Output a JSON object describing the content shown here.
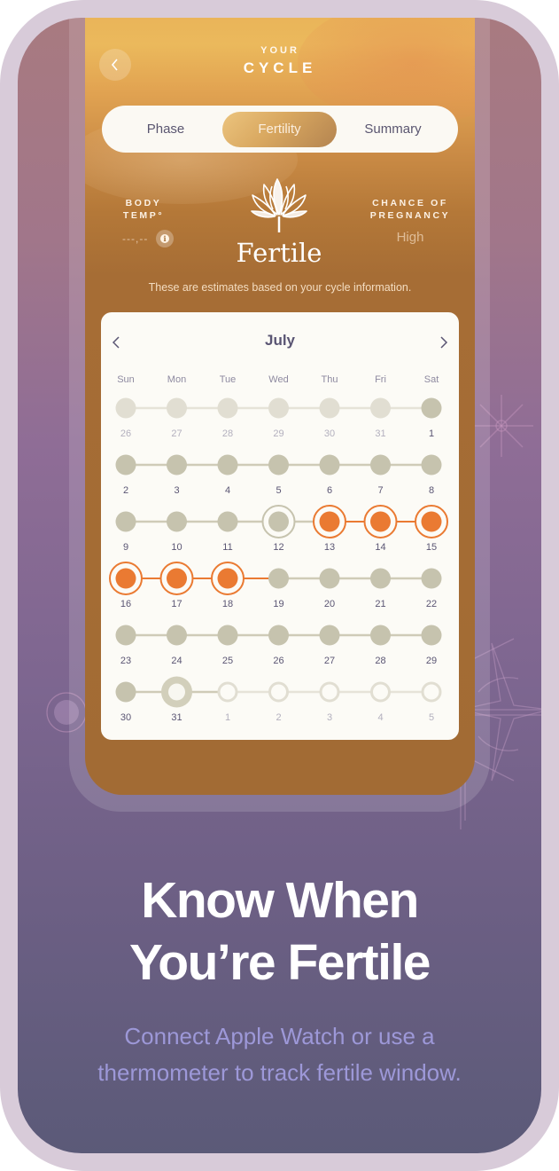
{
  "header": {
    "title_small": "YOUR",
    "title_big": "CYCLE",
    "back_icon": "chevron-left-icon"
  },
  "tabs": [
    {
      "label": "Phase",
      "active": false
    },
    {
      "label": "Fertility",
      "active": true
    },
    {
      "label": "Summary",
      "active": false
    }
  ],
  "body_temp": {
    "label_line1": "BODY",
    "label_line2": "TEMP°",
    "value": "---,--",
    "info_icon": "i"
  },
  "phase": {
    "icon": "lotus-flower-icon",
    "title": "Fertile"
  },
  "chance_of_pregnancy": {
    "label_line1": "CHANCE OF",
    "label_line2": "PREGNANCY",
    "value": "High"
  },
  "disclaimer": "These are estimates based on your cycle information.",
  "calendar": {
    "month": "July",
    "prev_icon": "chevron-left-icon",
    "next_icon": "chevron-right-icon",
    "weekdays": [
      "Sun",
      "Mon",
      "Tue",
      "Wed",
      "Thu",
      "Fri",
      "Sat"
    ],
    "weeks": [
      [
        {
          "day": "26",
          "state": "prev-month"
        },
        {
          "day": "27",
          "state": "prev-month"
        },
        {
          "day": "28",
          "state": "prev-month"
        },
        {
          "day": "29",
          "state": "prev-month"
        },
        {
          "day": "30",
          "state": "prev-month"
        },
        {
          "day": "31",
          "state": "prev-month"
        },
        {
          "day": "1",
          "state": "past"
        }
      ],
      [
        {
          "day": "2",
          "state": "past"
        },
        {
          "day": "3",
          "state": "past"
        },
        {
          "day": "4",
          "state": "past"
        },
        {
          "day": "5",
          "state": "past"
        },
        {
          "day": "6",
          "state": "past"
        },
        {
          "day": "7",
          "state": "past"
        },
        {
          "day": "8",
          "state": "past"
        }
      ],
      [
        {
          "day": "9",
          "state": "past"
        },
        {
          "day": "10",
          "state": "past"
        },
        {
          "day": "11",
          "state": "past"
        },
        {
          "day": "12",
          "state": "highlighted"
        },
        {
          "day": "13",
          "state": "fertile"
        },
        {
          "day": "14",
          "state": "fertile"
        },
        {
          "day": "15",
          "state": "fertile"
        }
      ],
      [
        {
          "day": "16",
          "state": "fertile"
        },
        {
          "day": "17",
          "state": "fertile"
        },
        {
          "day": "18",
          "state": "fertile"
        },
        {
          "day": "19",
          "state": "past"
        },
        {
          "day": "20",
          "state": "past"
        },
        {
          "day": "21",
          "state": "past"
        },
        {
          "day": "22",
          "state": "past"
        }
      ],
      [
        {
          "day": "23",
          "state": "past"
        },
        {
          "day": "24",
          "state": "past"
        },
        {
          "day": "25",
          "state": "past"
        },
        {
          "day": "26",
          "state": "past"
        },
        {
          "day": "27",
          "state": "past"
        },
        {
          "day": "28",
          "state": "past"
        },
        {
          "day": "29",
          "state": "past"
        }
      ],
      [
        {
          "day": "30",
          "state": "past"
        },
        {
          "day": "31",
          "state": "today"
        },
        {
          "day": "1",
          "state": "next-month"
        },
        {
          "day": "2",
          "state": "next-month"
        },
        {
          "day": "3",
          "state": "next-month"
        },
        {
          "day": "4",
          "state": "next-month"
        },
        {
          "day": "5",
          "state": "next-month"
        }
      ]
    ],
    "colors": {
      "fertile": "#ea7a32",
      "dot": "#c6c3ae",
      "dot_faded": "#e1ded2",
      "line": "#cfcbb7",
      "line_faded": "#e6e3d8",
      "label": "#5a5573",
      "label_faded": "#b3b0be",
      "weekday": "#8e8aa0"
    }
  },
  "promo": {
    "headline_line1": "Know When",
    "headline_line2": "You’re Fertile",
    "subline_line1": "Connect Apple Watch or use a",
    "subline_line2": "thermometer to track fertile window."
  }
}
